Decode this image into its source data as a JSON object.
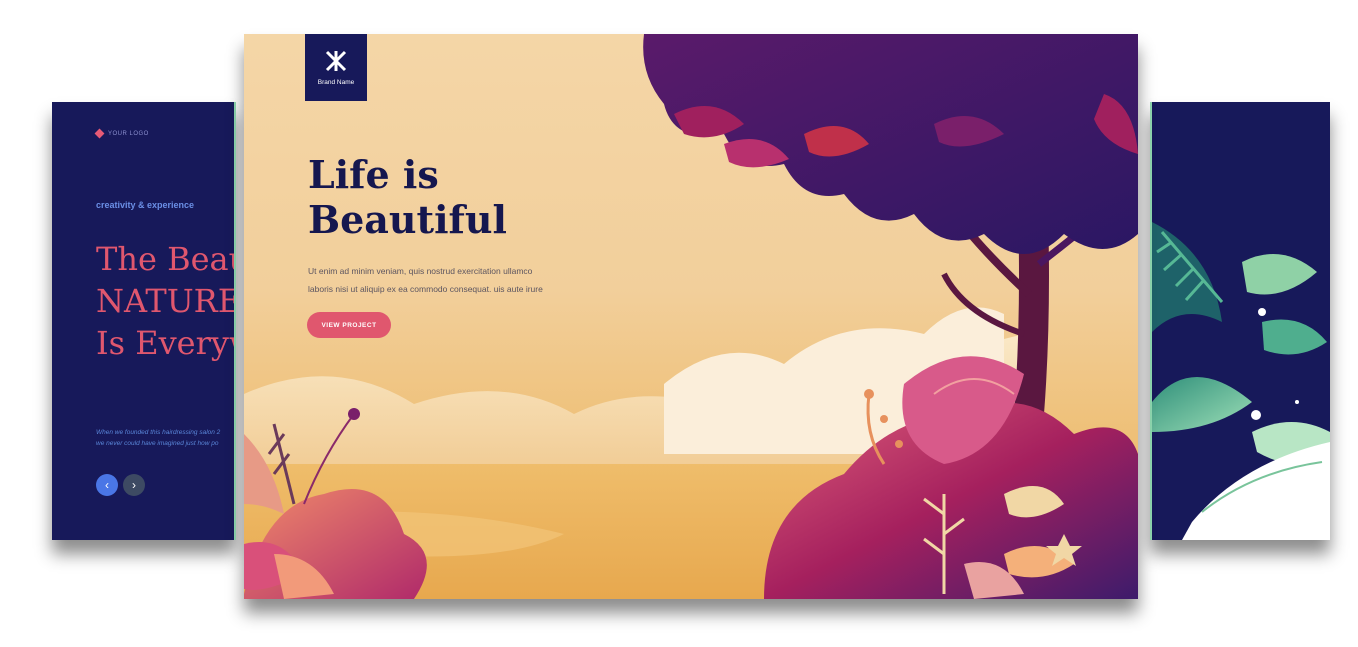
{
  "left_slide": {
    "logo": "YOUR LOGO",
    "tagline": "creativity & experience",
    "headline_lines": [
      "The Beau",
      "NATURE",
      "Is Everyw"
    ],
    "body_lines": [
      "When we founded this hairdressing salon 2",
      "we never could have imagined just how po"
    ],
    "prev_symbol": "‹",
    "next_symbol": "›"
  },
  "main_slide": {
    "brand_name": "Brand Name",
    "title_lines": [
      "Life is",
      "Beautiful"
    ],
    "text_lines": [
      "Ut enim ad minim veniam, quis nostrud exercitation ullamco",
      "laboris nisi ut aliquip ex ea commodo consequat. uis aute irure"
    ],
    "cta_label": "VIEW PROJECT"
  },
  "colors": {
    "navy": "#17195a",
    "coral": "#e0576e",
    "accent_blue": "#4a76e6",
    "sand": "#f2cf9b",
    "mint_border": "#8fd8b0"
  }
}
